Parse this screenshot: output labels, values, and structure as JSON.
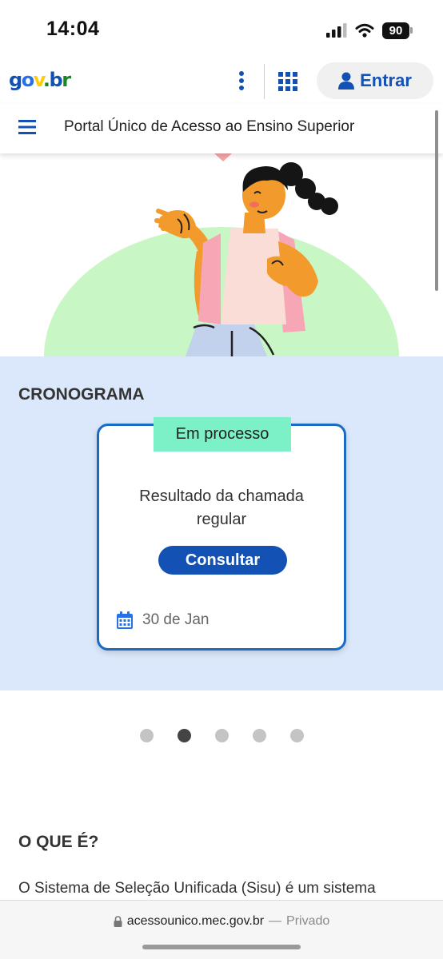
{
  "status_bar": {
    "time": "14:04",
    "battery": "90",
    "icons": [
      "cellular-signal-icon",
      "wifi-icon",
      "battery-icon"
    ]
  },
  "header": {
    "logo": "gov.br",
    "menu_icon": "kebab-menu-icon",
    "apps_icon": "apps-grid-icon",
    "login_icon": "user-icon",
    "login_label": "Entrar"
  },
  "portal": {
    "menu_icon": "hamburger-menu-icon",
    "title": "Portal Único de Acesso ao Ensino Superior"
  },
  "cronograma": {
    "heading": "CRONOGRAMA",
    "card": {
      "status": "Em processo",
      "description": "Resultado da chamada regular",
      "button_label": "Consultar",
      "date_icon": "calendar-icon",
      "date": "30 de Jan"
    }
  },
  "carousel": {
    "total_slides": 5,
    "active_index": 1
  },
  "oque_e": {
    "heading": "O QUE É?",
    "text": "O Sistema de Seleção Unificada (Sisu) é um sistema"
  },
  "browser": {
    "lock_icon": "lock-icon",
    "domain": "acessounico.mec.gov.br",
    "separator": "—",
    "mode": "Privado"
  },
  "colors": {
    "primary": "#1351b4",
    "section_bg": "#dbe8fb",
    "status_tag": "#7cf0c7",
    "card_border": "#1a6bc4",
    "hero_circle": "#c8f7c5"
  }
}
